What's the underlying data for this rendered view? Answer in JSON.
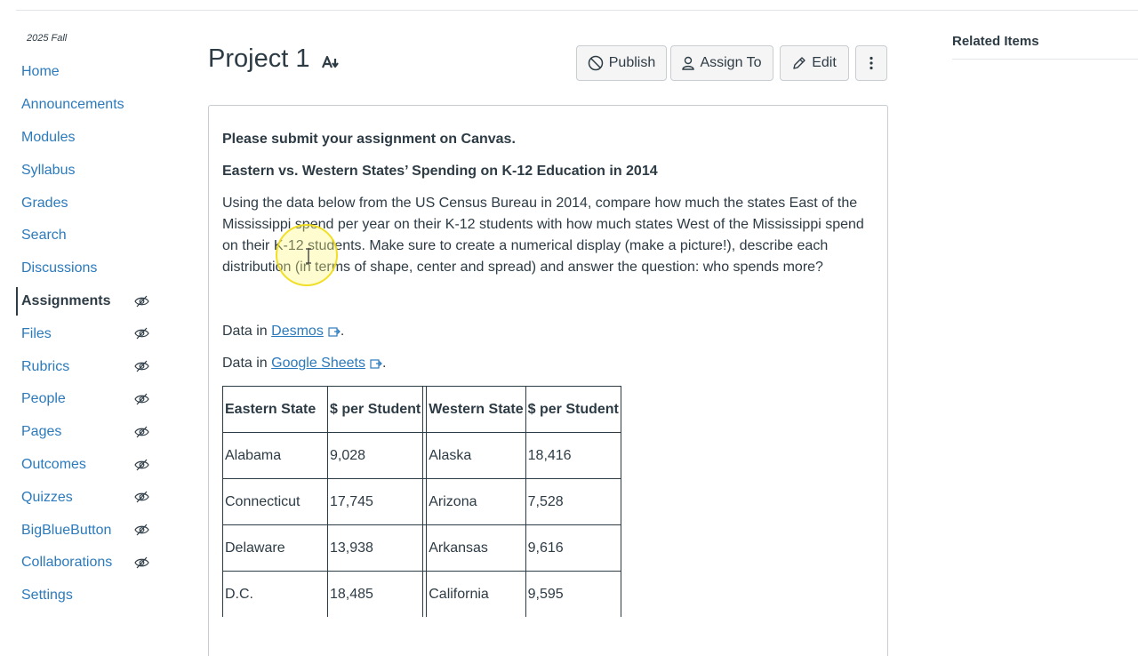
{
  "sidebar": {
    "term": "2025 Fall",
    "items": [
      {
        "label": "Home",
        "hidden": false,
        "active": false
      },
      {
        "label": "Announcements",
        "hidden": false,
        "active": false
      },
      {
        "label": "Modules",
        "hidden": false,
        "active": false
      },
      {
        "label": "Syllabus",
        "hidden": false,
        "active": false
      },
      {
        "label": "Grades",
        "hidden": false,
        "active": false
      },
      {
        "label": "Search",
        "hidden": false,
        "active": false
      },
      {
        "label": "Discussions",
        "hidden": false,
        "active": false
      },
      {
        "label": "Assignments",
        "hidden": true,
        "active": true
      },
      {
        "label": "Files",
        "hidden": true,
        "active": false
      },
      {
        "label": "Rubrics",
        "hidden": true,
        "active": false
      },
      {
        "label": "People",
        "hidden": true,
        "active": false
      },
      {
        "label": "Pages",
        "hidden": true,
        "active": false
      },
      {
        "label": "Outcomes",
        "hidden": true,
        "active": false
      },
      {
        "label": "Quizzes",
        "hidden": true,
        "active": false
      },
      {
        "label": "BigBlueButton",
        "hidden": true,
        "active": false
      },
      {
        "label": "Collaborations",
        "hidden": true,
        "active": false
      },
      {
        "label": "Settings",
        "hidden": false,
        "active": false
      }
    ]
  },
  "header": {
    "title": "Project 1",
    "publish_label": "Publish",
    "assign_label": "Assign To",
    "edit_label": "Edit"
  },
  "content": {
    "submit_note": "Please submit your assignment on Canvas.",
    "heading": "Eastern vs. Western States’ Spending on K-12 Education in 2014",
    "paragraph": "Using the data below from the US Census Bureau in 2014, compare how much the states East of the Mississippi spend per year on their K-12 students with how much states West of the Mississippi spend on their K-12 students.  Make sure to create a numerical display (make a picture!), describe each distribution (in terms of shape, center and spread) and answer the question: who spends more?",
    "desmos": {
      "prefix": "Data in ",
      "link": "Desmos",
      "suffix": "."
    },
    "sheets": {
      "prefix": "Data in ",
      "link": "Google Sheets",
      "suffix": "."
    }
  },
  "table": {
    "headers": [
      "Eastern State",
      "$ per Student",
      "Western State",
      "$ per Student"
    ],
    "rows": [
      [
        "Alabama",
        "9,028",
        "Alaska",
        "18,416"
      ],
      [
        "Connecticut",
        "17,745",
        "Arizona",
        "7,528"
      ],
      [
        "Delaware",
        "13,938",
        "Arkansas",
        "9,616"
      ],
      [
        "D.C.",
        "18,485",
        "California",
        "9,595"
      ]
    ]
  },
  "related": {
    "title": "Related Items"
  },
  "colors": {
    "link": "#2b7abc",
    "text": "#2d3b45",
    "border": "#c7cdd1"
  }
}
